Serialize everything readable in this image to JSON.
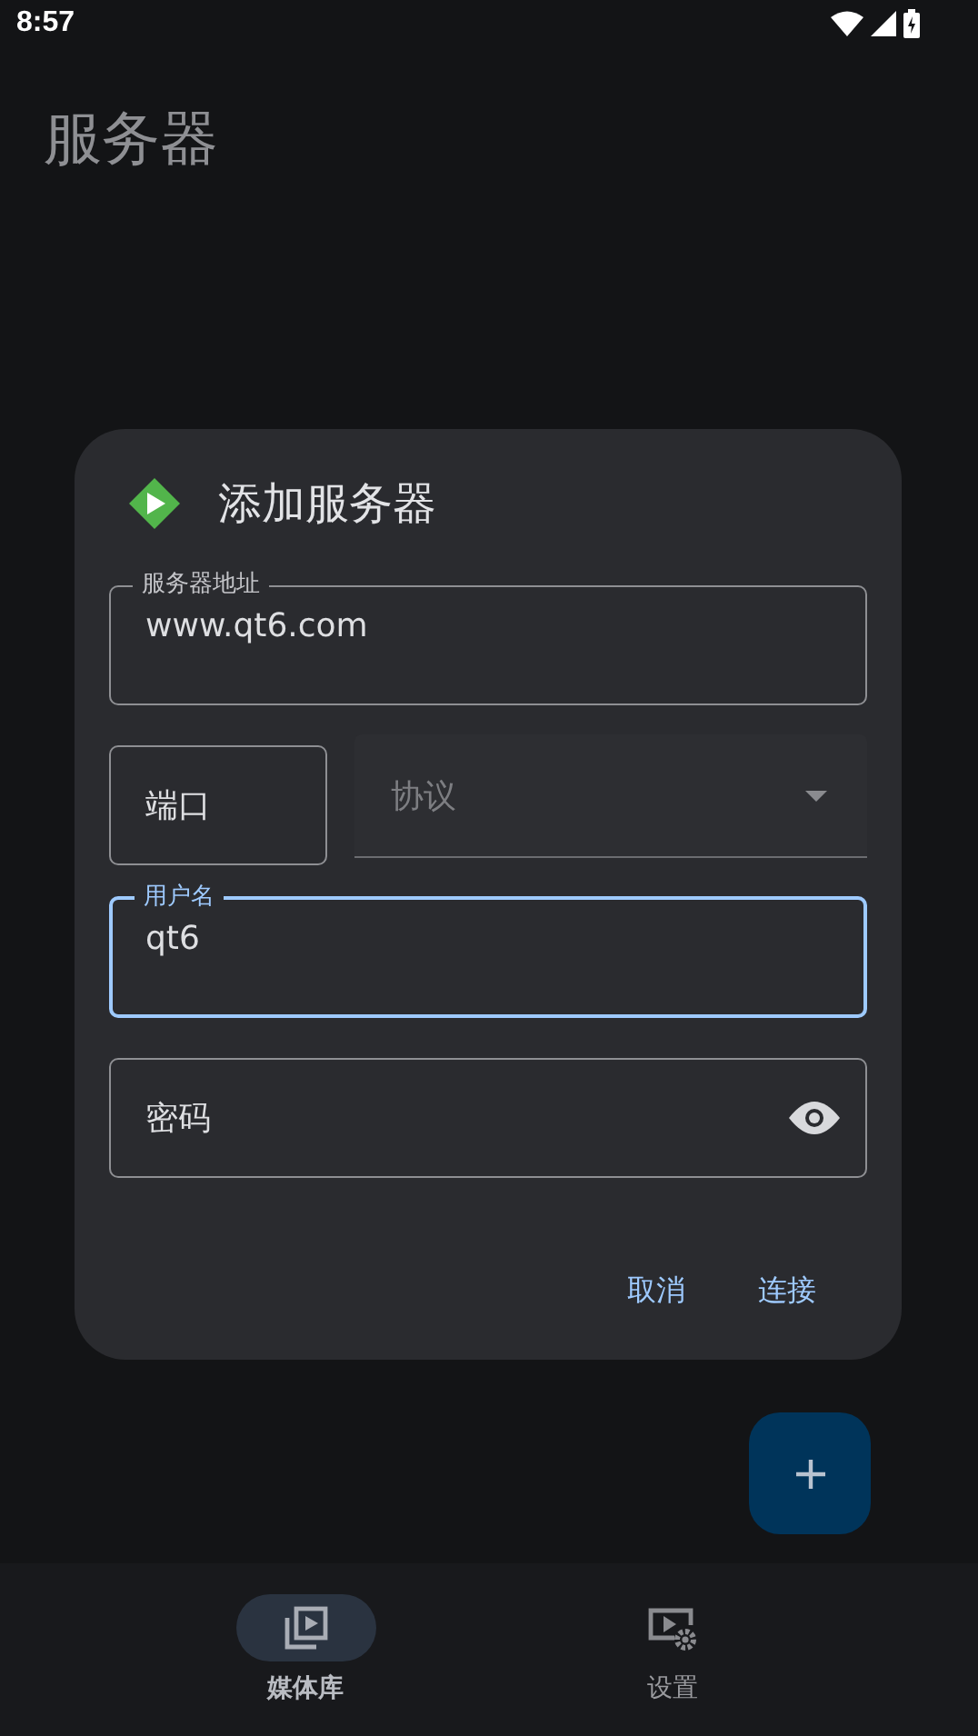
{
  "status_bar": {
    "time": "8:57"
  },
  "page_title": "服务器",
  "dialog": {
    "title": "添加服务器",
    "address_field": {
      "label": "服务器地址",
      "value": "www.qt6.com",
      "focused": false
    },
    "port_field": {
      "placeholder": "端口",
      "focused": false
    },
    "protocol_field": {
      "placeholder": "协议",
      "disabled": true
    },
    "username_field": {
      "label": "用户名",
      "value": "qt6",
      "focused": true
    },
    "password_field": {
      "placeholder": "密码",
      "focused": false
    },
    "buttons": [
      "取消",
      "连接"
    ]
  },
  "nav_items": [
    {
      "label": "媒体库",
      "kind": "library",
      "selected": true
    },
    {
      "label": "设置",
      "kind": "settings",
      "selected": false
    }
  ]
}
